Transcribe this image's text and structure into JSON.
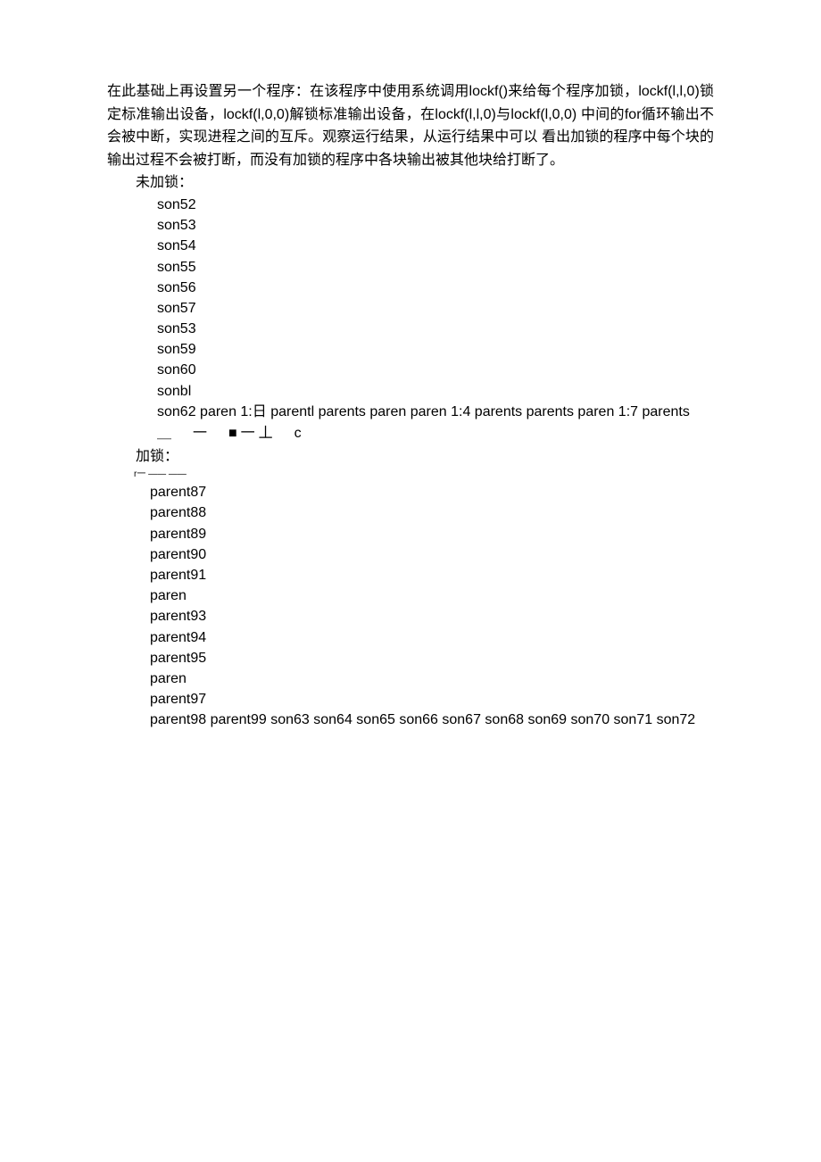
{
  "paragraph": "在此基础上再设置另一个程序：在该程序中使用系统调用lockf()来给每个程序加锁，lockf(l,l,0)锁定标准输出设备，lockf(l,0,0)解锁标准输出设备，在lockf(l,l,0)与lockf(l,0,0) 中间的for循环输出不会被中断，实现进程之间的互斥。观察运行结果，从运行结果中可以 看出加锁的程序中每个块的输出过程不会被打断，而没有加锁的程序中各块输出被其他块给打断了。",
  "unlocked_label": "未加锁：",
  "unlocked_lines": [
    "son52",
    "son53",
    "son54",
    "son55",
    "son56",
    "son57",
    "son53",
    "son59",
    "son60",
    "sonbl"
  ],
  "unlocked_last": "son62 paren 1:日  parentl parents paren paren 1:4 parents parents paren 1:7 parents",
  "symbol_line": "＿　一　■一丄　c",
  "locked_label": "加锁：",
  "top_decor": "r一 —— ——",
  "locked_lines": [
    "parent87",
    "parent88",
    "parent89",
    "parent90",
    "parent91",
    "paren",
    "parent93",
    "parent94",
    "parent95",
    "paren",
    "parent97"
  ],
  "locked_last": "parent98 parent99 son63 son64 son65 son66 son67 son68 son69 son70 son71 son72"
}
